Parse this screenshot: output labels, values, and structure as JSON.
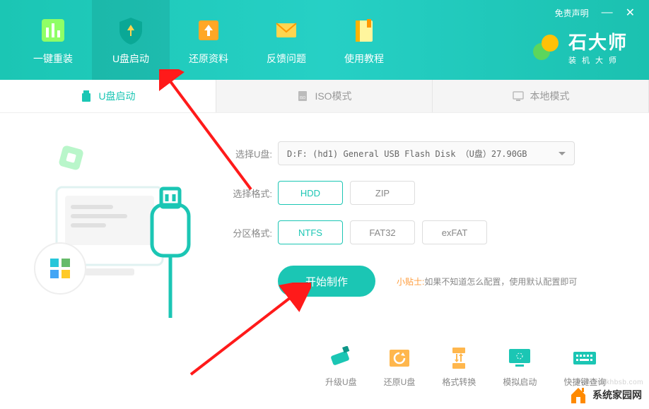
{
  "titlebar": {
    "disclaimer": "免责声明"
  },
  "nav": {
    "items": [
      {
        "label": "一键重装"
      },
      {
        "label": "U盘启动"
      },
      {
        "label": "还原资料"
      },
      {
        "label": "反馈问题"
      },
      {
        "label": "使用教程"
      }
    ]
  },
  "brand": {
    "name": "石大师",
    "sub": "装机大师"
  },
  "subtabs": {
    "items": [
      {
        "label": "U盘启动"
      },
      {
        "label": "ISO模式"
      },
      {
        "label": "本地模式"
      }
    ]
  },
  "form": {
    "select_u_label": "选择U盘:",
    "select_u_value": "D:F: (hd1) General USB Flash Disk （U盘）27.90GB",
    "format_label": "选择格式:",
    "format_opts": [
      "HDD",
      "ZIP"
    ],
    "partition_label": "分区格式:",
    "partition_opts": [
      "NTFS",
      "FAT32",
      "exFAT"
    ]
  },
  "action": {
    "start": "开始制作",
    "tip_label": "小贴士:",
    "tip_text": "如果不知道怎么配置，使用默认配置即可"
  },
  "tools": {
    "items": [
      {
        "label": "升级U盘"
      },
      {
        "label": "还原U盘"
      },
      {
        "label": "格式转换"
      },
      {
        "label": "模拟启动"
      },
      {
        "label": "快捷键查询"
      }
    ]
  },
  "watermark": {
    "text": "系统家园网",
    "url": "www.hnzkhbsb.com"
  }
}
